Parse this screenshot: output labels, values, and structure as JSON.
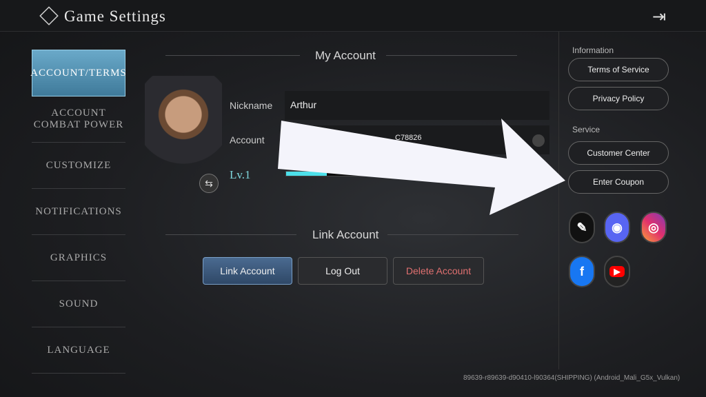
{
  "header": {
    "title": "Game Settings",
    "exit_icon": "exit-icon"
  },
  "sidebar": {
    "items": [
      {
        "label": "Account/Terms",
        "active": true
      },
      {
        "label": "Account Combat Power"
      },
      {
        "label": "Customize"
      },
      {
        "label": "Notifications"
      },
      {
        "label": "Graphics"
      },
      {
        "label": "Sound"
      },
      {
        "label": "Language"
      }
    ]
  },
  "my_account": {
    "title": "My Account",
    "nickname_label": "Nickname",
    "nickname": "Arthur",
    "account_label": "Account",
    "account_value": "C78826",
    "level": "Lv.1",
    "exp_progress": 0.16
  },
  "link_account": {
    "title": "Link Account",
    "buttons": [
      "Link Account",
      "Log Out",
      "Delete Account"
    ]
  },
  "right": {
    "information": "Information",
    "terms": "Terms of Service",
    "privacy": "Privacy Policy",
    "service": "Service",
    "customer": "Customer Center",
    "coupon": "Enter Coupon",
    "social": [
      "edit",
      "discord",
      "instagram",
      "facebook",
      "youtube"
    ]
  },
  "build": "89639-r89639-d90410-l90364(SHIPPING)    (Android_Mali_G5x_Vulkan)",
  "colors": {
    "accent": "#4de0ea",
    "active_tab": "#5b98b9",
    "delete": "#e07070"
  }
}
